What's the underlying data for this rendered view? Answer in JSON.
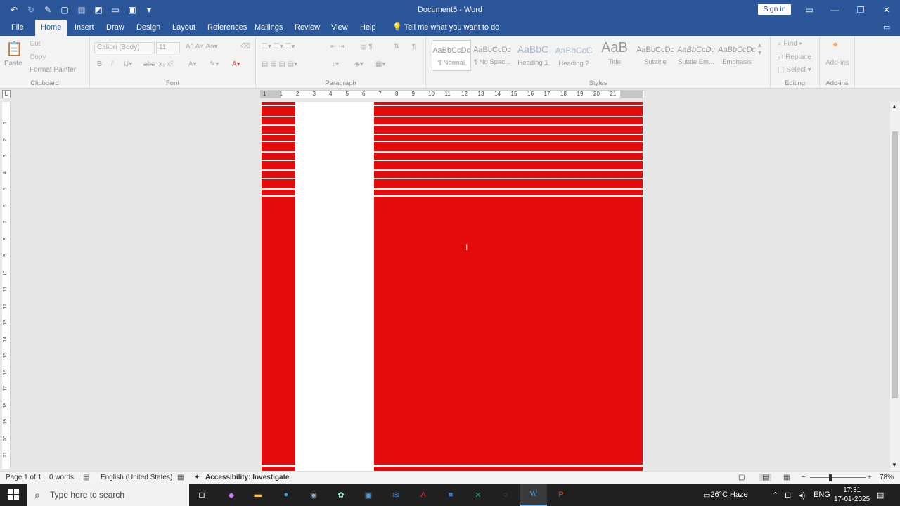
{
  "window": {
    "title": "Document5 - Word",
    "signin_label": "Sign in"
  },
  "tabs": [
    "File",
    "Home",
    "Insert",
    "Draw",
    "Design",
    "Layout",
    "References",
    "Mailings",
    "Review",
    "View",
    "Help"
  ],
  "tell_me": "Tell me what you want to do",
  "ribbon": {
    "clipboard": {
      "paste": "Paste",
      "cut": "Cut",
      "copy": "Copy",
      "format_painter": "Format Painter",
      "label": "Clipboard"
    },
    "font": {
      "name": "Calibri (Body)",
      "size": "11",
      "label": "Font"
    },
    "paragraph": {
      "label": "Paragraph"
    },
    "styles": {
      "label": "Styles",
      "items": [
        {
          "preview": "AaBbCcDc",
          "name": "¶ Normal"
        },
        {
          "preview": "AaBbCcDc",
          "name": "¶ No Spac..."
        },
        {
          "preview": "AaBbC",
          "name": "Heading 1"
        },
        {
          "preview": "AaBbCcC",
          "name": "Heading 2"
        },
        {
          "preview": "AaB",
          "name": "Title"
        },
        {
          "preview": "AaBbCcDc",
          "name": "Subtitle"
        },
        {
          "preview": "AaBbCcDc",
          "name": "Subtle Em..."
        },
        {
          "preview": "AaBbCcDc",
          "name": "Emphasis"
        }
      ]
    },
    "editing": {
      "find": "Find",
      "replace": "Replace",
      "select": "Select",
      "label": "Editing"
    },
    "addins": {
      "button": "Add-ins",
      "label": "Add-ins"
    }
  },
  "ruler_numbers": [
    "1",
    "1",
    "2",
    "3",
    "4",
    "5",
    "6",
    "7",
    "8",
    "9",
    "10",
    "11",
    "12",
    "13",
    "14",
    "15",
    "16",
    "17",
    "18",
    "19",
    "20",
    "21"
  ],
  "vruler_numbers": [
    "1",
    "2",
    "3",
    "4",
    "5",
    "6",
    "7",
    "8",
    "9",
    "10",
    "11",
    "12",
    "13",
    "14",
    "15",
    "16",
    "17",
    "18",
    "19",
    "20",
    "21"
  ],
  "ruler_corner": "L",
  "status": {
    "page": "Page 1 of 1",
    "words": "0 words",
    "language": "English (United States)",
    "accessibility": "Accessibility: Investigate",
    "zoom": "78%"
  },
  "taskbar": {
    "search_placeholder": "Type here to search",
    "weather": "26°C  Haze",
    "lang": "ENG",
    "time": "17:31",
    "date": "17-01-2025"
  },
  "colors": {
    "accent": "#2b579a",
    "page_fill": "#e30b0b"
  }
}
